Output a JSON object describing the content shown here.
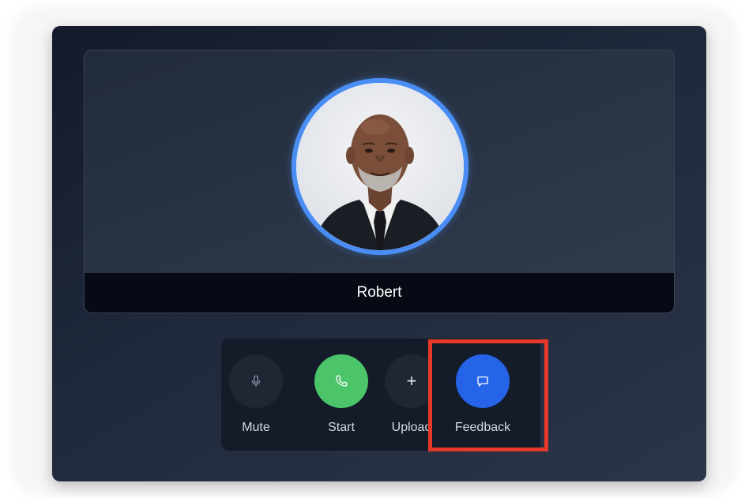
{
  "participant": {
    "name": "Robert",
    "avatar_alt": "Robert"
  },
  "controls": {
    "mute_label": "Mute",
    "start_label": "Start",
    "upload_label": "Upload",
    "feedback_label": "Feedback"
  },
  "colors": {
    "avatar_ring": "#4a8ef5",
    "start_button": "#4cc469",
    "feedback_button": "#2563e8",
    "highlight_box": "#e8382a"
  },
  "icons": {
    "mute": "microphone-icon",
    "start": "phone-icon",
    "upload": "plus-icon",
    "feedback": "chat-bubble-icon"
  }
}
